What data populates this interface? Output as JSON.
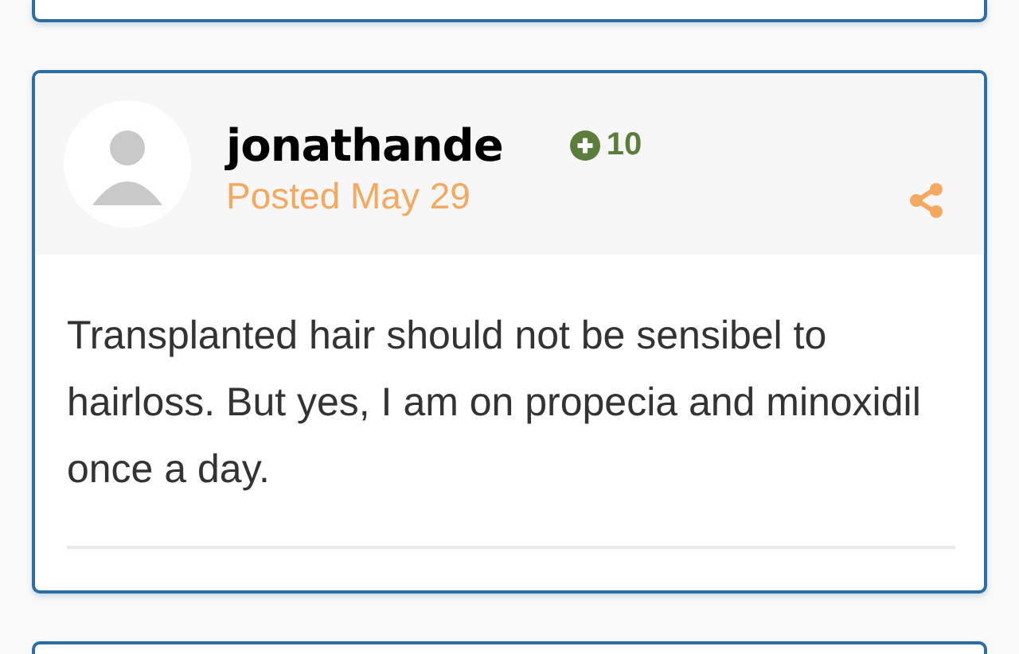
{
  "post": {
    "author": "jonathande",
    "reputation": "10",
    "posted": "Posted May 29",
    "body": "Transplanted hair should not be sensibel to hairloss. But yes, I am on propecia and minoxidil once a day."
  }
}
